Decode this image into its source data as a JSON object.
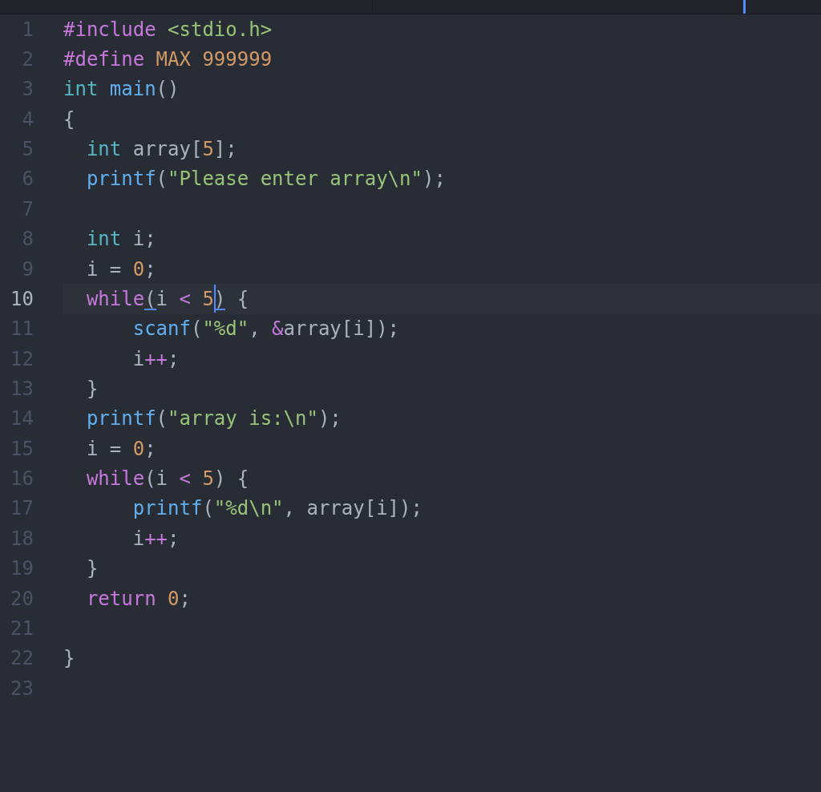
{
  "editor": {
    "lines": [
      {
        "number": "1",
        "current": false,
        "tokens": [
          {
            "kind": "keyword",
            "text": "#include"
          },
          {
            "kind": "string",
            "text": " <stdio.h>"
          }
        ]
      },
      {
        "number": "2",
        "current": false,
        "tokens": [
          {
            "kind": "keyword",
            "text": "#define"
          },
          {
            "kind": "number",
            "text": " MAX"
          },
          {
            "kind": "number",
            "text": " 999999"
          }
        ]
      },
      {
        "number": "3",
        "current": false,
        "tokens": [
          {
            "kind": "type",
            "text": "int"
          },
          {
            "kind": "function",
            "text": " main"
          },
          {
            "kind": "punct",
            "text": "()"
          }
        ]
      },
      {
        "number": "4",
        "current": false,
        "tokens": [
          {
            "kind": "punct",
            "text": "{"
          }
        ]
      },
      {
        "number": "5",
        "current": false,
        "tokens": [
          {
            "kind": "type",
            "text": "  int"
          },
          {
            "kind": "plain",
            "text": " array"
          },
          {
            "kind": "punct",
            "text": "["
          },
          {
            "kind": "number",
            "text": "5"
          },
          {
            "kind": "punct",
            "text": "];"
          }
        ]
      },
      {
        "number": "6",
        "current": false,
        "tokens": [
          {
            "kind": "function",
            "text": "  printf"
          },
          {
            "kind": "punct",
            "text": "("
          },
          {
            "kind": "string",
            "text": "\"Please enter array\\n\""
          },
          {
            "kind": "punct",
            "text": ");"
          }
        ]
      },
      {
        "number": "7",
        "current": false
      },
      {
        "number": "8",
        "current": false,
        "tokens": [
          {
            "kind": "type",
            "text": "  int"
          },
          {
            "kind": "plain",
            "text": " i;"
          }
        ]
      },
      {
        "number": "9",
        "current": false,
        "tokens": [
          {
            "kind": "plain",
            "text": "  i ="
          },
          {
            "kind": "number",
            "text": " 0"
          },
          {
            "kind": "punct",
            "text": ";"
          }
        ]
      },
      {
        "number": "10",
        "current": true,
        "tokens": [
          {
            "kind": "keyword",
            "text": "  while"
          },
          {
            "kind": "punct",
            "text": "(",
            "matched": true
          },
          {
            "kind": "plain",
            "text": "i"
          },
          {
            "kind": "operator",
            "text": " <"
          },
          {
            "kind": "number",
            "text": " 5",
            "cursor": true
          },
          {
            "kind": "punct",
            "text": ")",
            "matched": true
          },
          {
            "kind": "punct",
            "text": " {"
          }
        ]
      },
      {
        "number": "11",
        "current": false,
        "tokens": [
          {
            "kind": "function",
            "text": "      scanf"
          },
          {
            "kind": "punct",
            "text": "("
          },
          {
            "kind": "string",
            "text": "\"%d\""
          },
          {
            "kind": "punct",
            "text": ","
          },
          {
            "kind": "operator",
            "text": " &"
          },
          {
            "kind": "plain",
            "text": "array"
          },
          {
            "kind": "punct",
            "text": "[i]);"
          }
        ]
      },
      {
        "number": "12",
        "current": false,
        "tokens": [
          {
            "kind": "plain",
            "text": "      i"
          },
          {
            "kind": "operator",
            "text": "++"
          },
          {
            "kind": "punct",
            "text": ";"
          }
        ]
      },
      {
        "number": "13",
        "current": false,
        "tokens": [
          {
            "kind": "punct",
            "text": "  }"
          }
        ]
      },
      {
        "number": "14",
        "current": false,
        "tokens": [
          {
            "kind": "function",
            "text": "  printf"
          },
          {
            "kind": "punct",
            "text": "("
          },
          {
            "kind": "string",
            "text": "\"array is:\\n\""
          },
          {
            "kind": "punct",
            "text": ");"
          }
        ]
      },
      {
        "number": "15",
        "current": false,
        "tokens": [
          {
            "kind": "plain",
            "text": "  i ="
          },
          {
            "kind": "number",
            "text": " 0"
          },
          {
            "kind": "punct",
            "text": ";"
          }
        ]
      },
      {
        "number": "16",
        "current": false,
        "tokens": [
          {
            "kind": "keyword",
            "text": "  while"
          },
          {
            "kind": "punct",
            "text": "("
          },
          {
            "kind": "plain",
            "text": "i"
          },
          {
            "kind": "operator",
            "text": " <"
          },
          {
            "kind": "number",
            "text": " 5"
          },
          {
            "kind": "punct",
            "text": ")"
          },
          {
            "kind": "punct",
            "text": " {"
          }
        ]
      },
      {
        "number": "17",
        "current": false,
        "tokens": [
          {
            "kind": "function",
            "text": "      printf"
          },
          {
            "kind": "punct",
            "text": "("
          },
          {
            "kind": "string",
            "text": "\"%d\\n\""
          },
          {
            "kind": "punct",
            "text": ","
          },
          {
            "kind": "plain",
            "text": " array"
          },
          {
            "kind": "punct",
            "text": "[i]);"
          }
        ]
      },
      {
        "number": "18",
        "current": false,
        "tokens": [
          {
            "kind": "plain",
            "text": "      i"
          },
          {
            "kind": "operator",
            "text": "++"
          },
          {
            "kind": "punct",
            "text": ";"
          }
        ]
      },
      {
        "number": "19",
        "current": false,
        "tokens": [
          {
            "kind": "punct",
            "text": "  }"
          }
        ]
      },
      {
        "number": "20",
        "current": false,
        "tokens": [
          {
            "kind": "keyword",
            "text": "  return"
          },
          {
            "kind": "number",
            "text": " 0"
          },
          {
            "kind": "punct",
            "text": ";"
          }
        ]
      },
      {
        "number": "21",
        "current": false
      },
      {
        "number": "22",
        "current": false,
        "tokens": [
          {
            "kind": "punct",
            "text": "}"
          }
        ]
      },
      {
        "number": "23",
        "current": false
      }
    ]
  }
}
